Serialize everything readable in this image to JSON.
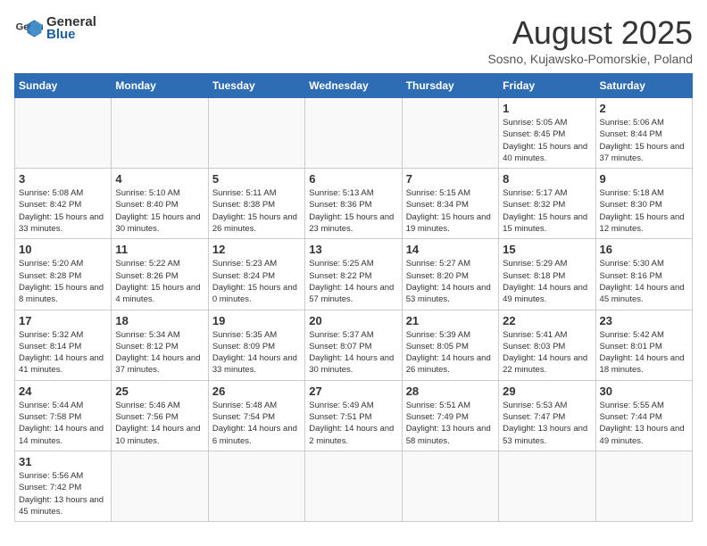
{
  "header": {
    "logo_general": "General",
    "logo_blue": "Blue",
    "title": "August 2025",
    "subtitle": "Sosno, Kujawsko-Pomorskie, Poland"
  },
  "weekdays": [
    "Sunday",
    "Monday",
    "Tuesday",
    "Wednesday",
    "Thursday",
    "Friday",
    "Saturday"
  ],
  "weeks": [
    [
      {
        "day": "",
        "info": ""
      },
      {
        "day": "",
        "info": ""
      },
      {
        "day": "",
        "info": ""
      },
      {
        "day": "",
        "info": ""
      },
      {
        "day": "",
        "info": ""
      },
      {
        "day": "1",
        "info": "Sunrise: 5:05 AM\nSunset: 8:45 PM\nDaylight: 15 hours\nand 40 minutes."
      },
      {
        "day": "2",
        "info": "Sunrise: 5:06 AM\nSunset: 8:44 PM\nDaylight: 15 hours\nand 37 minutes."
      }
    ],
    [
      {
        "day": "3",
        "info": "Sunrise: 5:08 AM\nSunset: 8:42 PM\nDaylight: 15 hours\nand 33 minutes."
      },
      {
        "day": "4",
        "info": "Sunrise: 5:10 AM\nSunset: 8:40 PM\nDaylight: 15 hours\nand 30 minutes."
      },
      {
        "day": "5",
        "info": "Sunrise: 5:11 AM\nSunset: 8:38 PM\nDaylight: 15 hours\nand 26 minutes."
      },
      {
        "day": "6",
        "info": "Sunrise: 5:13 AM\nSunset: 8:36 PM\nDaylight: 15 hours\nand 23 minutes."
      },
      {
        "day": "7",
        "info": "Sunrise: 5:15 AM\nSunset: 8:34 PM\nDaylight: 15 hours\nand 19 minutes."
      },
      {
        "day": "8",
        "info": "Sunrise: 5:17 AM\nSunset: 8:32 PM\nDaylight: 15 hours\nand 15 minutes."
      },
      {
        "day": "9",
        "info": "Sunrise: 5:18 AM\nSunset: 8:30 PM\nDaylight: 15 hours\nand 12 minutes."
      }
    ],
    [
      {
        "day": "10",
        "info": "Sunrise: 5:20 AM\nSunset: 8:28 PM\nDaylight: 15 hours\nand 8 minutes."
      },
      {
        "day": "11",
        "info": "Sunrise: 5:22 AM\nSunset: 8:26 PM\nDaylight: 15 hours\nand 4 minutes."
      },
      {
        "day": "12",
        "info": "Sunrise: 5:23 AM\nSunset: 8:24 PM\nDaylight: 15 hours\nand 0 minutes."
      },
      {
        "day": "13",
        "info": "Sunrise: 5:25 AM\nSunset: 8:22 PM\nDaylight: 14 hours\nand 57 minutes."
      },
      {
        "day": "14",
        "info": "Sunrise: 5:27 AM\nSunset: 8:20 PM\nDaylight: 14 hours\nand 53 minutes."
      },
      {
        "day": "15",
        "info": "Sunrise: 5:29 AM\nSunset: 8:18 PM\nDaylight: 14 hours\nand 49 minutes."
      },
      {
        "day": "16",
        "info": "Sunrise: 5:30 AM\nSunset: 8:16 PM\nDaylight: 14 hours\nand 45 minutes."
      }
    ],
    [
      {
        "day": "17",
        "info": "Sunrise: 5:32 AM\nSunset: 8:14 PM\nDaylight: 14 hours\nand 41 minutes."
      },
      {
        "day": "18",
        "info": "Sunrise: 5:34 AM\nSunset: 8:12 PM\nDaylight: 14 hours\nand 37 minutes."
      },
      {
        "day": "19",
        "info": "Sunrise: 5:35 AM\nSunset: 8:09 PM\nDaylight: 14 hours\nand 33 minutes."
      },
      {
        "day": "20",
        "info": "Sunrise: 5:37 AM\nSunset: 8:07 PM\nDaylight: 14 hours\nand 30 minutes."
      },
      {
        "day": "21",
        "info": "Sunrise: 5:39 AM\nSunset: 8:05 PM\nDaylight: 14 hours\nand 26 minutes."
      },
      {
        "day": "22",
        "info": "Sunrise: 5:41 AM\nSunset: 8:03 PM\nDaylight: 14 hours\nand 22 minutes."
      },
      {
        "day": "23",
        "info": "Sunrise: 5:42 AM\nSunset: 8:01 PM\nDaylight: 14 hours\nand 18 minutes."
      }
    ],
    [
      {
        "day": "24",
        "info": "Sunrise: 5:44 AM\nSunset: 7:58 PM\nDaylight: 14 hours\nand 14 minutes."
      },
      {
        "day": "25",
        "info": "Sunrise: 5:46 AM\nSunset: 7:56 PM\nDaylight: 14 hours\nand 10 minutes."
      },
      {
        "day": "26",
        "info": "Sunrise: 5:48 AM\nSunset: 7:54 PM\nDaylight: 14 hours\nand 6 minutes."
      },
      {
        "day": "27",
        "info": "Sunrise: 5:49 AM\nSunset: 7:51 PM\nDaylight: 14 hours\nand 2 minutes."
      },
      {
        "day": "28",
        "info": "Sunrise: 5:51 AM\nSunset: 7:49 PM\nDaylight: 13 hours\nand 58 minutes."
      },
      {
        "day": "29",
        "info": "Sunrise: 5:53 AM\nSunset: 7:47 PM\nDaylight: 13 hours\nand 53 minutes."
      },
      {
        "day": "30",
        "info": "Sunrise: 5:55 AM\nSunset: 7:44 PM\nDaylight: 13 hours\nand 49 minutes."
      }
    ],
    [
      {
        "day": "31",
        "info": "Sunrise: 5:56 AM\nSunset: 7:42 PM\nDaylight: 13 hours\nand 45 minutes."
      },
      {
        "day": "",
        "info": ""
      },
      {
        "day": "",
        "info": ""
      },
      {
        "day": "",
        "info": ""
      },
      {
        "day": "",
        "info": ""
      },
      {
        "day": "",
        "info": ""
      },
      {
        "day": "",
        "info": ""
      }
    ]
  ]
}
